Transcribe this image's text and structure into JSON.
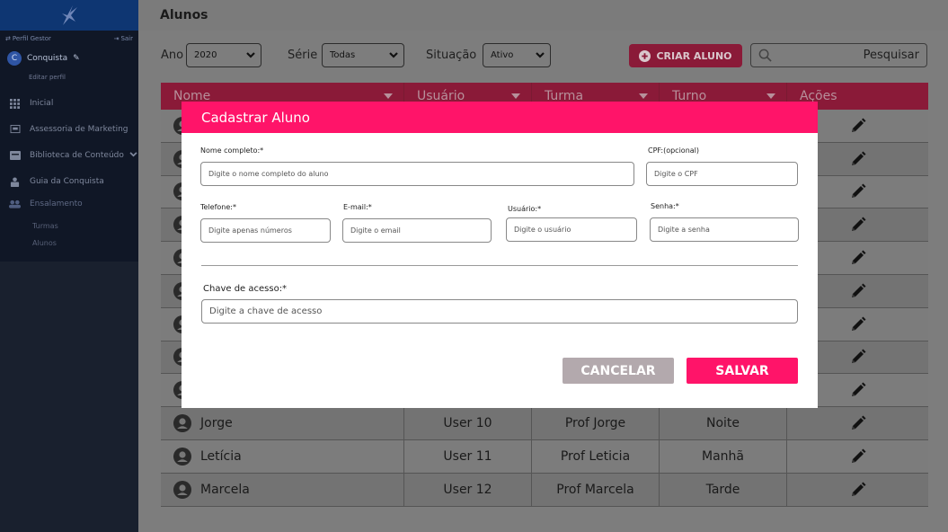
{
  "sidebar": {
    "perfil_label": "Perfil Gestor",
    "sair_label": "Sair",
    "user_initial": "C",
    "user_name": "Conquista",
    "edit_profile": "Editar perfil",
    "items": [
      {
        "label": "Inicial",
        "icon": "grid-icon"
      },
      {
        "label": "Assessoria de Marketing",
        "icon": "presentation-icon"
      },
      {
        "label": "Biblioteca de Conteúdo",
        "icon": "library-icon"
      },
      {
        "label": "Guia da Conquista",
        "icon": "guide-icon"
      },
      {
        "label": "Ensalamento",
        "icon": "users-icon"
      }
    ],
    "subitems": [
      {
        "label": "Turmas"
      },
      {
        "label": "Alunos"
      }
    ]
  },
  "header": {
    "title": "Alunos"
  },
  "filters": {
    "ano_label": "Ano",
    "ano_value": "2020",
    "serie_label": "Série",
    "serie_value": "Todas",
    "situacao_label": "Situação",
    "situacao_value": "Ativo",
    "create_button": "CRIAR ALUNO",
    "search_placeholder": "Pesquisar"
  },
  "table": {
    "columns": [
      "Nome",
      "Usuário",
      "Turma",
      "Turno",
      "Ações"
    ],
    "rows": [
      {
        "nome": "",
        "usuario": "",
        "turma": "",
        "turno": ""
      },
      {
        "nome": "",
        "usuario": "",
        "turma": "",
        "turno": ""
      },
      {
        "nome": "",
        "usuario": "",
        "turma": "",
        "turno": ""
      },
      {
        "nome": "",
        "usuario": "",
        "turma": "",
        "turno": ""
      },
      {
        "nome": "",
        "usuario": "",
        "turma": "",
        "turno": ""
      },
      {
        "nome": "",
        "usuario": "",
        "turma": "",
        "turno": ""
      },
      {
        "nome": "",
        "usuario": "",
        "turma": "",
        "turno": ""
      },
      {
        "nome": "",
        "usuario": "",
        "turma": "",
        "turno": ""
      },
      {
        "nome": "",
        "usuario": "",
        "turma": "",
        "turno": ""
      },
      {
        "nome": "Jorge",
        "usuario": "User 10",
        "turma": "Prof Jorge",
        "turno": "Noite"
      },
      {
        "nome": "Letícia",
        "usuario": "User 11",
        "turma": "Prof Leticia",
        "turno": "Manhã"
      },
      {
        "nome": "Marcela",
        "usuario": "User 12",
        "turma": "Prof Marcela",
        "turno": "Tarde"
      }
    ]
  },
  "modal": {
    "title": "Cadastrar Aluno",
    "nome_label": "Nome completo:*",
    "nome_placeholder": "Digite o nome completo do aluno",
    "cpf_label": "CPF:(opcional)",
    "cpf_placeholder": "Digite o CPF",
    "telefone_label": "Telefone:*",
    "telefone_placeholder": "Digite apenas números",
    "email_label": "E-mail:*",
    "email_placeholder": "Digite o email",
    "usuario_label": "Usuário:*",
    "usuario_placeholder": "Digite o usuário",
    "senha_label": "Senha:*",
    "senha_placeholder": "Digite a senha",
    "chave_label": "Chave de acesso:*",
    "chave_placeholder": "Digite a chave de acesso",
    "cancel_button": "CANCELAR",
    "save_button": "SALVAR"
  },
  "colors": {
    "accent": "#ff1469",
    "sidebar": "#19202e",
    "brand_bar": "#0e3672"
  }
}
